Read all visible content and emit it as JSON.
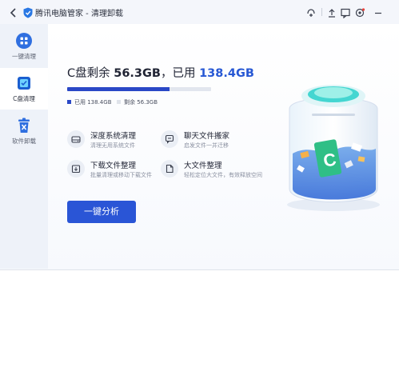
{
  "titlebar": {
    "title": "腾讯电脑管家 - 清理卸载",
    "icons": [
      "back-icon",
      "shield-logo-icon",
      "scan-icon",
      "upload-icon",
      "feedback-icon",
      "settings-icon",
      "minimize-icon"
    ]
  },
  "sidebar": {
    "items": [
      {
        "label": "一键清理",
        "icon": "grid-icon",
        "active": false
      },
      {
        "label": "C盘清理",
        "icon": "disk-icon",
        "active": true
      },
      {
        "label": "软件卸载",
        "icon": "trash-icon",
        "active": false
      }
    ]
  },
  "disk": {
    "prefix": "C盘剩余",
    "free": "56.3GB",
    "sep": "，已用",
    "used": "138.4GB",
    "used_legend": "已用 138.4GB",
    "free_legend": "剩余 56.3GB",
    "used_fraction": 0.71,
    "used_color": "#2a48c6",
    "free_color": "#e2e6ee"
  },
  "features": [
    {
      "title": "深度系统清理",
      "desc": "清理无用系统文件",
      "icon": "drive-icon"
    },
    {
      "title": "聊天文件搬家",
      "desc": "启发文件一并迁移",
      "icon": "chat-files-icon"
    },
    {
      "title": "下载文件整理",
      "desc": "批量清理或移动下载文件",
      "icon": "download-folder-icon"
    },
    {
      "title": "大文件整理",
      "desc": "轻松定位大文件，有效释放空间",
      "icon": "file-icon"
    }
  ],
  "actions": {
    "analyze_label": "一键分析"
  },
  "colors": {
    "accent": "#2a55d6",
    "usage": "#2a48c6",
    "sidebar_bg": "#eef2f9"
  }
}
